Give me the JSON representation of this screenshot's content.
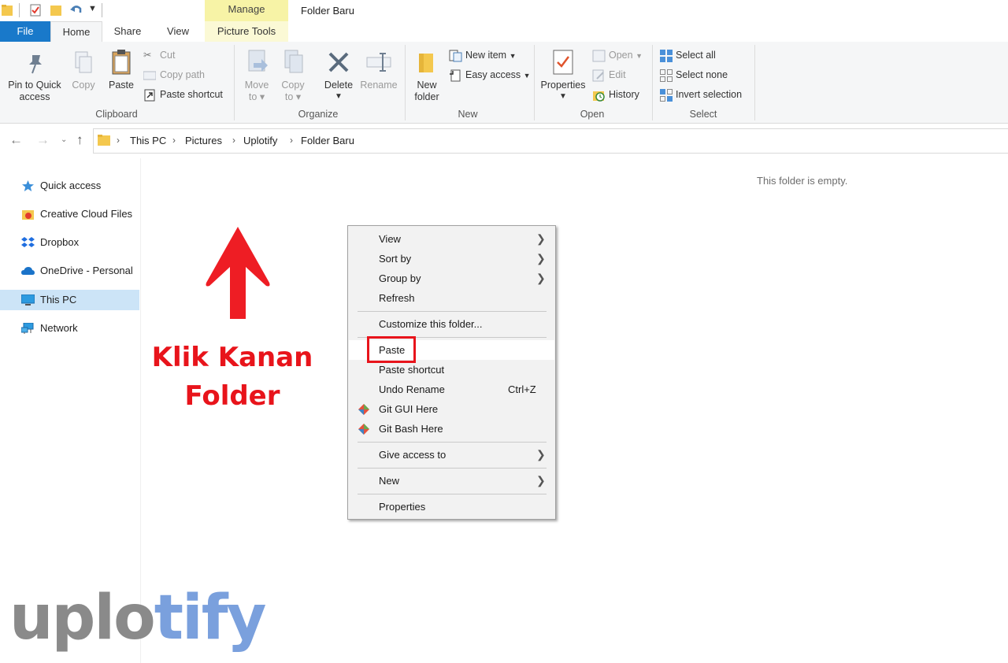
{
  "titlebar": {
    "manage_tab": "Manage",
    "window_title": "Folder Baru"
  },
  "tabs": {
    "file": "File",
    "home": "Home",
    "share": "Share",
    "view": "View",
    "picture_tools": "Picture Tools"
  },
  "ribbon": {
    "clipboard": {
      "label": "Clipboard",
      "pin_line1": "Pin to Quick",
      "pin_line2": "access",
      "copy": "Copy",
      "paste": "Paste",
      "cut": "Cut",
      "copy_path": "Copy path",
      "paste_shortcut": "Paste shortcut"
    },
    "organize": {
      "label": "Organize",
      "move_line1": "Move",
      "move_line2": "to",
      "copy_line1": "Copy",
      "copy_line2": "to",
      "delete": "Delete",
      "rename": "Rename"
    },
    "new": {
      "label": "New",
      "new_folder_line1": "New",
      "new_folder_line2": "folder",
      "new_item": "New item",
      "easy_access": "Easy access"
    },
    "open": {
      "label": "Open",
      "properties": "Properties",
      "open": "Open",
      "edit": "Edit",
      "history": "History"
    },
    "select": {
      "label": "Select",
      "select_all": "Select all",
      "select_none": "Select none",
      "invert_selection": "Invert selection"
    }
  },
  "breadcrumb": [
    "This PC",
    "Pictures",
    "Uplotify",
    "Folder Baru"
  ],
  "sidebar": {
    "items": [
      {
        "label": "Quick access"
      },
      {
        "label": "Creative Cloud Files"
      },
      {
        "label": "Dropbox"
      },
      {
        "label": "OneDrive - Personal"
      },
      {
        "label": "This PC"
      },
      {
        "label": "Network"
      }
    ]
  },
  "main": {
    "empty_text": "This folder is empty."
  },
  "annotation": {
    "line1": "Klik Kanan",
    "line2": "Folder"
  },
  "context_menu": {
    "view": "View",
    "sort_by": "Sort by",
    "group_by": "Group by",
    "refresh": "Refresh",
    "customize": "Customize this folder...",
    "paste": "Paste",
    "paste_shortcut": "Paste shortcut",
    "undo_rename": "Undo Rename",
    "undo_shortcut": "Ctrl+Z",
    "git_gui": "Git GUI Here",
    "git_bash": "Git Bash Here",
    "give_access": "Give access to",
    "new": "New",
    "properties": "Properties"
  },
  "watermark": {
    "part1": "uplo",
    "part2": "tify"
  },
  "colors": {
    "accent": "#1979ca",
    "selection": "#cce4f7",
    "annotation": "#e8141b"
  }
}
